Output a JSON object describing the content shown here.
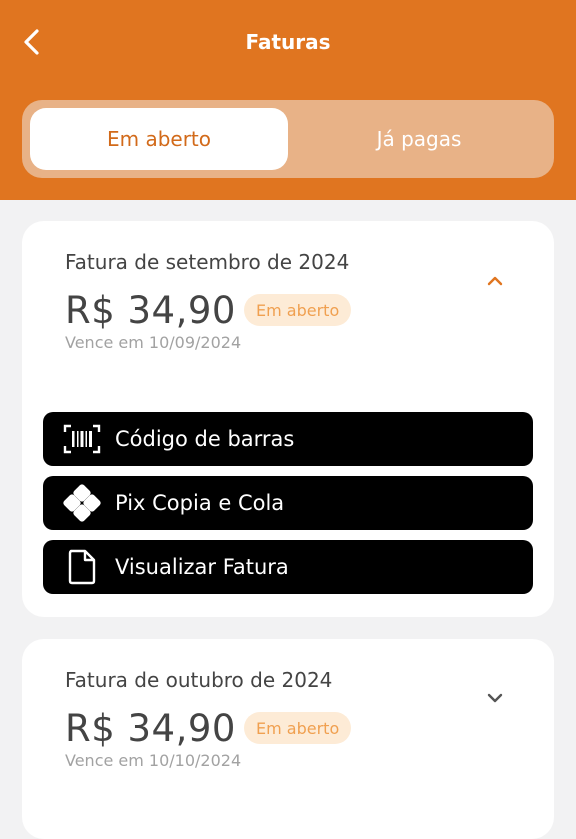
{
  "header": {
    "title": "Faturas",
    "back_icon": "chevron-left-icon"
  },
  "tabs": [
    {
      "label": "Em aberto",
      "active": true
    },
    {
      "label": "Já pagas",
      "active": false
    }
  ],
  "invoices": [
    {
      "title": "Fatura de setembro de 2024",
      "amount": "R$ 34,90",
      "status": "Em aberto",
      "due": "Vence em 10/09/2024",
      "expanded": true,
      "actions": [
        {
          "label": "Código de barras",
          "icon": "barcode-icon"
        },
        {
          "label": "Pix Copia e Cola",
          "icon": "pix-icon"
        },
        {
          "label": "Visualizar Fatura",
          "icon": "document-icon"
        }
      ]
    },
    {
      "title": "Fatura de outubro de 2024",
      "amount": "R$ 34,90",
      "status": "Em aberto",
      "due": "Vence em 10/10/2024",
      "expanded": false
    }
  ],
  "colors": {
    "brand": "#e07520",
    "badge_bg": "#fdebd6",
    "badge_text": "#f0a050",
    "button_bg": "#000000"
  }
}
